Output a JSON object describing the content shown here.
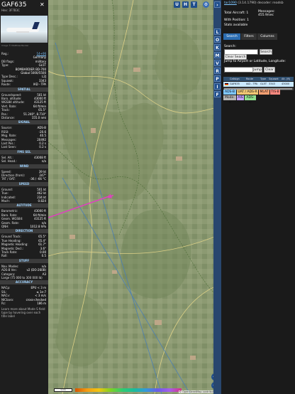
{
  "aircraft": {
    "callsign": "GAF635",
    "hex_line": "Hex:  3F7B3C",
    "close_icon": "close-icon",
    "photo_credit": "Image © Matthias Becker",
    "fields": [
      {
        "k": "Reg.:",
        "v": "14+06",
        "link": true
      },
      {
        "k": "",
        "v": "Germany"
      },
      {
        "k": "DB flags:",
        "v": "military"
      },
      {
        "k": "Type:",
        "v": "GL5T"
      },
      {
        "k": "",
        "v": "BOMBARDIER BD-700"
      },
      {
        "k": "",
        "v": "Global 5000/5500"
      },
      {
        "k": "Type Desc.:",
        "v": "L2J"
      },
      {
        "k": "Squawk:",
        "v": "3343"
      },
      {
        "k": "Route:",
        "v": "IAD - TPA"
      }
    ],
    "sections": [
      {
        "title": "SPATIAL",
        "rows": [
          {
            "k": "Groundspeed:",
            "v": "501 kt"
          },
          {
            "k": "Baro. altitude:",
            "v": "43000 ft"
          },
          {
            "k": "WGS84 altitude:",
            "v": "43125 ft"
          },
          {
            "k": "Vert. Rate:",
            "v": "64 ft/min"
          },
          {
            "k": "Track:",
            "v": "65.5°"
          },
          {
            "k": "Pos.:",
            "v": "51.240°, 8.710°"
          },
          {
            "k": "Distance:",
            "v": "155.0 nmi"
          }
        ]
      },
      {
        "title": "SIGNAL",
        "rows": [
          {
            "k": "Source:",
            "v": "ADS-B"
          },
          {
            "k": "RSSI:",
            "v": "-20.6"
          },
          {
            "k": "Msg. Rate:",
            "v": "40.5"
          },
          {
            "k": "Messages:",
            "v": "20492"
          },
          {
            "k": "Last Pos.:",
            "v": "0.2 s"
          },
          {
            "k": "Last Seen:",
            "v": "0.2 s"
          }
        ]
      },
      {
        "title": "FMS SEL",
        "rows": [
          {
            "k": "Sel. Alt.:",
            "v": "43008 ft"
          },
          {
            "k": "Sel. Head.:",
            "v": "n/a"
          }
        ]
      },
      {
        "title": "WIND",
        "rows": [
          {
            "k": "Speed:",
            "v": "39 kt"
          },
          {
            "k": "Direction (from):",
            "v": "247°"
          },
          {
            "k": "TAT / OAT:",
            "v": "-36 / -66 °C"
          }
        ]
      },
      {
        "title": "SPEED",
        "rows": [
          {
            "k": "Ground:",
            "v": "501 kt"
          },
          {
            "k": "True:",
            "v": "462 kt"
          },
          {
            "k": "Indicated:",
            "v": "234 kt"
          },
          {
            "k": "Mach:",
            "v": "0.824"
          }
        ]
      },
      {
        "title": "ALTITUDE",
        "rows": [
          {
            "k": "Barometric:",
            "v": "43000 ft"
          },
          {
            "k": "Baro. Rate:",
            "v": "64 ft/min"
          },
          {
            "k": "Geom. WGS84:",
            "v": "43125 ft"
          },
          {
            "k": "Geom. Rate:",
            "v": "n/a"
          },
          {
            "k": "QNH:",
            "v": "1012.8 hPa"
          }
        ]
      },
      {
        "title": "DIRECTION",
        "rows": [
          {
            "k": "Ground Track:",
            "v": "65.5°"
          },
          {
            "k": "True Heading:",
            "v": "65.4°"
          },
          {
            "k": "Magnetic Heading:",
            "v": "61.7°"
          },
          {
            "k": "Magnetic Decl.:",
            "v": "3.6°"
          },
          {
            "k": "Track Rate:",
            "v": "0.00"
          },
          {
            "k": "Roll:",
            "v": "0.5"
          }
        ]
      },
      {
        "title": "STUFF",
        "rows": [
          {
            "k": "Nav. Modes:",
            "v": "n/a"
          },
          {
            "k": "ADS-B Ver.:",
            "v": "v2 (DO-260B)"
          },
          {
            "k": "Category:",
            "v": "A3"
          }
        ]
      }
    ],
    "category_desc": "Large (75 000 to 300 000 lb)",
    "accuracy_title": "ACCURACY",
    "accuracy_rows": [
      {
        "k": "NACp:",
        "v": "EPU < 3 m"
      },
      {
        "k": "SIL:",
        "v": "≤ 1e-7"
      },
      {
        "k": "NACv:",
        "v": "< 3 m/s"
      },
      {
        "k": "NICbaro:",
        "v": "cross-checked"
      },
      {
        "k": "Rc:",
        "v": "186 m"
      }
    ],
    "footer_text": "Learn more about Mode S field type by hovering over each title label"
  },
  "map": {
    "top_buttons": [
      "U",
      "H",
      "T"
    ],
    "settings_icon": "gear-icon",
    "zoom_in": "+",
    "zoom_out": "−",
    "scale_label": "1 km",
    "attribution": "© OpenStreetMap contributors"
  },
  "toolbar": {
    "collapse_icon": "chevron-right-icon",
    "buttons": [
      "L",
      "O",
      "K",
      "M",
      "V",
      "R",
      "P",
      "I",
      "F"
    ]
  },
  "right": {
    "version_prefix": "tar1090",
    "version_suffix": " (3.14.1790) decoder: readsb",
    "total_aircraft": "Total Aircraft: 1",
    "messages_label": "Messages:",
    "messages_value": "455.9/sec",
    "with_position": "With Position: 1",
    "stats": "Stats available",
    "tabs": [
      "Search",
      "Filters",
      "Columns"
    ],
    "search_label": "Search:",
    "search_placeholder": "",
    "search_button": "Search",
    "clear_search_button": "Clear Search",
    "jump_label": "Jump to Airport or Latitude, Longitude:",
    "jump_button": "Jump",
    "clear_button": "Clear",
    "table_headers": [
      "Callsign",
      "Route",
      "Type",
      "Squawk",
      "Alt. (ft)"
    ],
    "table_row": [
      "GAF635",
      "IAD - TPA",
      "GL5T",
      "3343",
      "43000"
    ],
    "badges": [
      {
        "label": "ADS-B",
        "color": "#7fc7ff"
      },
      {
        "label": "UAT / ADS-R",
        "color": "#f0c674"
      },
      {
        "label": "MLAT",
        "color": "#f7a072"
      },
      {
        "label": "TIS-B",
        "color": "#ff8a80"
      },
      {
        "label": "Mode-S",
        "color": "#b5b5b5"
      },
      {
        "label": "AIS",
        "color": "#c5a3ff"
      },
      {
        "label": "ADS-C",
        "color": "#8fe08f"
      }
    ]
  },
  "colors": {
    "accent": "#1f4e8c",
    "section_header": "#9fd3ff",
    "aircraft_icon": "#e040c0",
    "track_line": "#e040c0"
  }
}
